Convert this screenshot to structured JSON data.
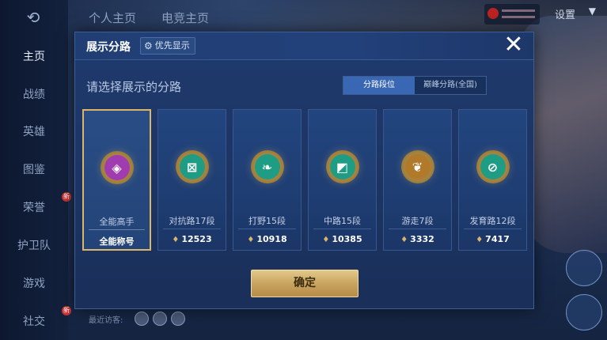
{
  "sidebar": {
    "items": [
      {
        "label": "主页",
        "badge": ""
      },
      {
        "label": "战绩",
        "badge": ""
      },
      {
        "label": "英雄",
        "badge": ""
      },
      {
        "label": "图鉴",
        "badge": ""
      },
      {
        "label": "荣誉",
        "badge": "新"
      },
      {
        "label": "护卫队",
        "badge": ""
      },
      {
        "label": "游戏",
        "badge": ""
      },
      {
        "label": "社交",
        "badge": "新"
      }
    ]
  },
  "topbar": {
    "tabs": [
      "个人主页",
      "电竞主页"
    ],
    "settings_label": "设置"
  },
  "dialog": {
    "title": "展示分路",
    "priority_label": "优先显示",
    "close_label": "✕",
    "prompt": "请选择展示的分路",
    "segments": [
      {
        "label": "分路段位",
        "active": true
      },
      {
        "label": "巅峰分路(全国)",
        "active": false
      }
    ],
    "cards": [
      {
        "name": "全能高手",
        "foot": "全能称号",
        "value_icon": "",
        "selected": true,
        "emblem_color": "#a03bb0",
        "glyph": "◈"
      },
      {
        "name": "对抗路17段",
        "foot": "12523",
        "value_icon": "♦",
        "selected": false,
        "emblem_color": "#1f9c84",
        "glyph": "⊠"
      },
      {
        "name": "打野15段",
        "foot": "10918",
        "value_icon": "♦",
        "selected": false,
        "emblem_color": "#1f9c84",
        "glyph": "❧"
      },
      {
        "name": "中路15段",
        "foot": "10385",
        "value_icon": "♦",
        "selected": false,
        "emblem_color": "#1f9c84",
        "glyph": "◩"
      },
      {
        "name": "游走7段",
        "foot": "3332",
        "value_icon": "♦",
        "selected": false,
        "emblem_color": "#b07a2a",
        "glyph": "❦"
      },
      {
        "name": "发育路12段",
        "foot": "7417",
        "value_icon": "♦",
        "selected": false,
        "emblem_color": "#1f9c84",
        "glyph": "⊘"
      }
    ],
    "confirm_label": "确定"
  },
  "bottom": {
    "visitors_label": "最近访客:"
  }
}
